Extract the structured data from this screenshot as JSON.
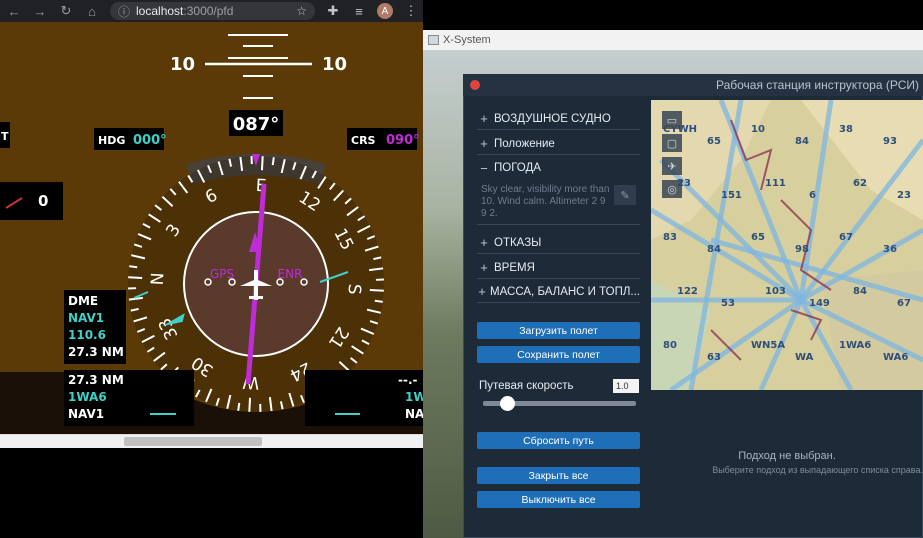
{
  "browser": {
    "url_host": "localhost",
    "url_path": ":3000/pfd",
    "avatar_letter": "A"
  },
  "pfd": {
    "pitch_label_left": "10",
    "pitch_label_right": "10",
    "heading_readout": "087°",
    "hdg_label": "HDG",
    "hdg_value": "000°",
    "crs_label": "CRS",
    "crs_value": "090°",
    "left_partial_value": "0",
    "left_partial_letter": "T",
    "gps_label": "GPS",
    "enr_label": "ENR",
    "compass_labels": [
      "N",
      "3",
      "6",
      "E",
      "12",
      "15",
      "S",
      "21",
      "24",
      "W",
      "30",
      "33"
    ],
    "dme_box": {
      "title": "DME",
      "source": "NAV1",
      "freq": "110.6",
      "dist": "27.3 NM"
    },
    "bearing_left": {
      "dist": "27.3 NM",
      "ident": "1WA6",
      "source": "NAV1"
    },
    "bearing_right": {
      "dist": "--.-",
      "ident": "1W",
      "source": "NA"
    }
  },
  "xsystem": {
    "window_title": "X-System",
    "panel_title": "Рабочая станция инструктора (РСИ)",
    "sections": [
      {
        "symbol": "+",
        "label": "ВОЗДУШНОЕ СУДНО"
      },
      {
        "symbol": "+",
        "label": "Положение"
      },
      {
        "symbol": "−",
        "label": "ПОГОДА"
      },
      {
        "symbol": "+",
        "label": "ОТКАЗЫ"
      },
      {
        "symbol": "+",
        "label": "ВРЕМЯ"
      },
      {
        "symbol": "+",
        "label": "МАССА, БАЛАНС И ТОПЛ..."
      }
    ],
    "weather_text": "Sky clear, visibility more than 10. Wind calm. Altimeter 2 9 9 2.",
    "buttons": {
      "load": "Загрузить полет",
      "save": "Сохранить полет",
      "reset_path": "Сбросить путь",
      "close_all": "Закрыть все",
      "shutdown_all": "Выключить все"
    },
    "speed_label": "Путевая скорость",
    "speed_value": "1.0",
    "approach_title": "Подход не выбран.",
    "approach_hint": "Выберите подход из выпадающего списка справа.",
    "map_labels": [
      "CYWH",
      "65",
      "10",
      "84",
      "38",
      "93",
      "23",
      "151",
      "111",
      "6",
      "62",
      "23",
      "83",
      "84",
      "65",
      "98",
      "67",
      "36",
      "122",
      "53",
      "103",
      "149",
      "84",
      "67",
      "80",
      "63",
      "WN5A",
      "WA",
      "1WA6",
      "WA6"
    ],
    "colors": {
      "accent": "#1f6fb8",
      "pfd_bg": "#5b3a08",
      "magenta": "#c02bd8",
      "cyan": "#3fd0c8"
    }
  }
}
